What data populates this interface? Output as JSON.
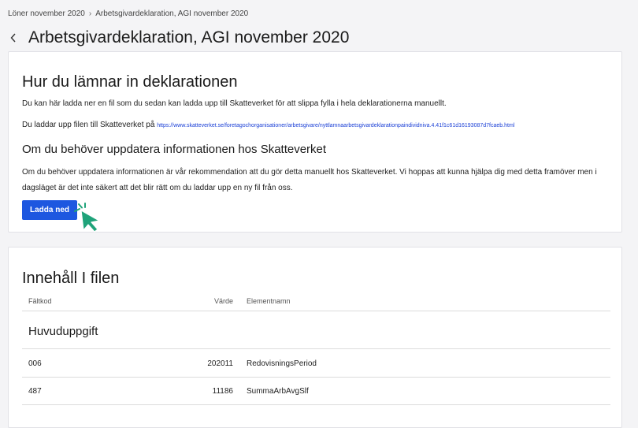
{
  "breadcrumb": {
    "items": [
      "Löner november 2020",
      "Arbetsgivardeklaration, AGI november 2020"
    ],
    "separator": "›"
  },
  "header": {
    "title": "Arbetsgivardeklaration, AGI november 2020"
  },
  "instructions": {
    "heading": "Hur du lämnar in deklarationen",
    "paragraph1": "Du kan här ladda ner en fil som du sedan kan ladda upp till Skatteverket för att slippa fylla i hela deklarationerna manuellt.",
    "paragraph2_prefix": "Du laddar upp filen till Skatteverket på",
    "link": "https://www.skatteverket.se/foretagochorganisationer/arbetsgivare/nyttlamnaarbetsgivardeklarationpaindividniva.4.41f1c61d16193087d7fcaeb.html",
    "subheading": "Om du behöver uppdatera informationen hos Skatteverket",
    "paragraph3": "Om du behöver uppdatera informationen är vår rekommendation att du gör detta manuellt hos Skatteverket. Vi hoppas att kunna hjälpa dig med detta framöver men i dagsläget är det inte säkert att det blir rätt om du laddar upp en ny fil från oss.",
    "download_label": "Ladda ned"
  },
  "contents": {
    "heading": "Innehåll I filen",
    "columns": [
      "Fältkod",
      "Värde",
      "Elementnamn"
    ],
    "section": "Huvuduppgift",
    "rows": [
      {
        "code": "006",
        "value": "202011",
        "name": "RedovisningsPeriod"
      },
      {
        "code": "487",
        "value": "11186",
        "name": "SummaArbAvgSlf"
      }
    ]
  },
  "colors": {
    "accent": "#1d57e0",
    "cursor": "#1fa37a",
    "link": "#1a3fd6"
  },
  "icons": {
    "back": "chevron-left-icon",
    "cursor": "pointer-cursor-icon"
  }
}
